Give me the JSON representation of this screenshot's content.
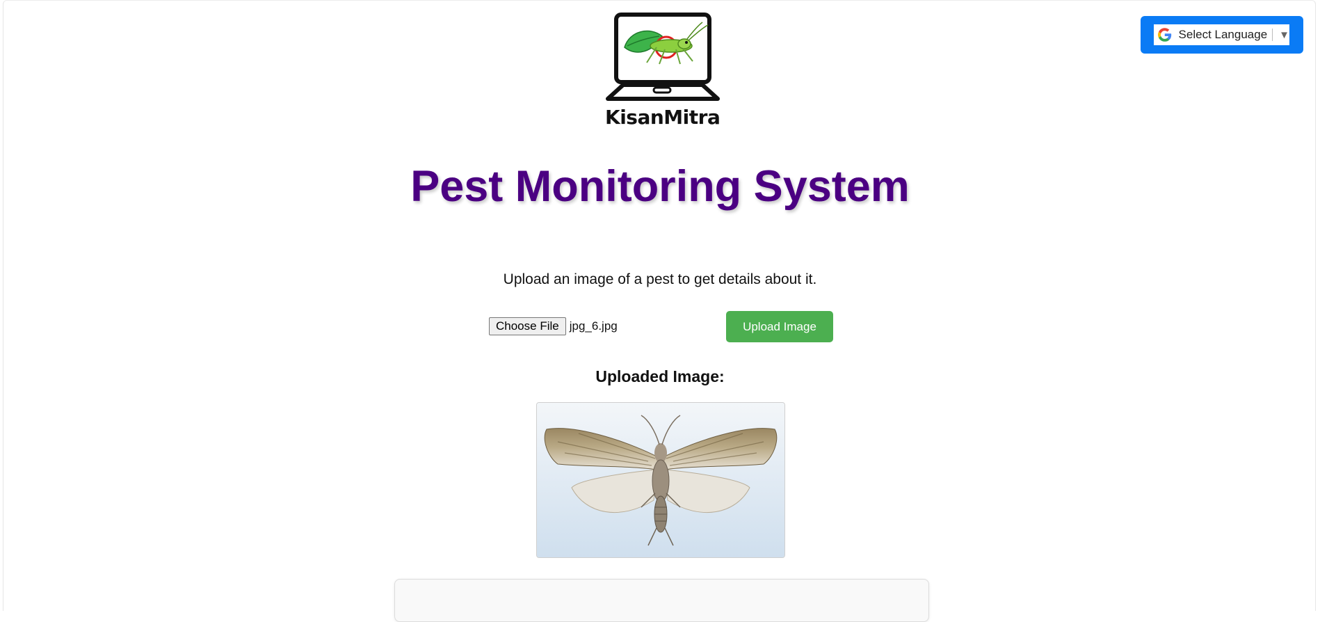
{
  "header": {
    "brand_name": "KisanMitra",
    "language_selector": {
      "label": "Select Language",
      "icon": "google-g-icon",
      "arrow": "▼",
      "accent_color": "#0a7bf5"
    }
  },
  "main": {
    "title": "Pest Monitoring System",
    "title_color": "#4b0082",
    "instruction": "Upload an image of a pest to get details about it.",
    "file_input": {
      "button_label": "Choose File",
      "selected_file": "jpg_6.jpg"
    },
    "upload_button": {
      "label": "Upload Image",
      "color": "#4caf50"
    },
    "uploaded_heading": "Uploaded Image:",
    "uploaded_image_subject": "moth-image"
  }
}
